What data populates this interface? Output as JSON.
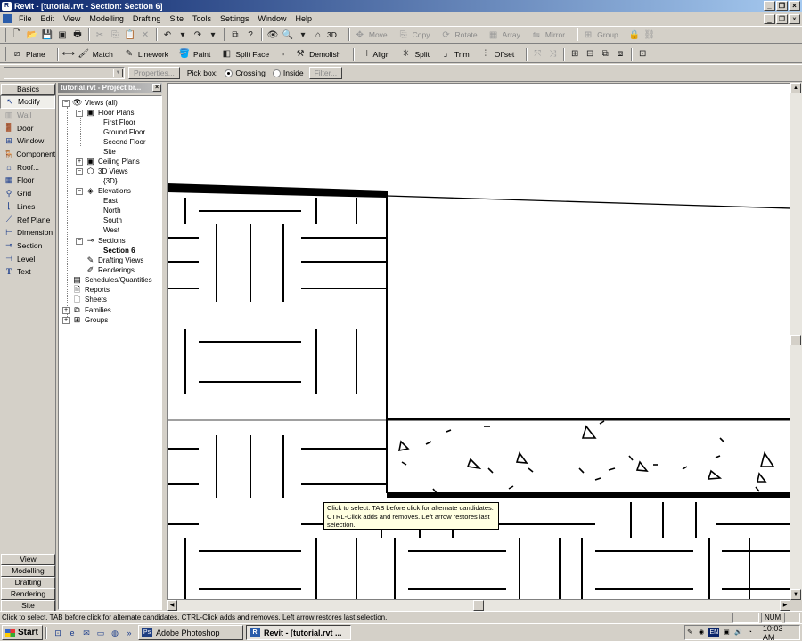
{
  "window": {
    "title": "Revit - [tutorial.rvt - Section: Section 6]"
  },
  "menu": [
    "File",
    "Edit",
    "View",
    "Modelling",
    "Drafting",
    "Site",
    "Tools",
    "Settings",
    "Window",
    "Help"
  ],
  "toolbar1": {
    "view3d_label": "3D",
    "edit_tools": [
      "Move",
      "Copy",
      "Rotate",
      "Array",
      "Mirror",
      "Group"
    ]
  },
  "toolbar2": {
    "tools": [
      "Plane",
      "Match",
      "Linework",
      "Paint",
      "Split Face",
      "Demolish",
      "Align",
      "Split",
      "Trim",
      "Offset"
    ]
  },
  "options_bar": {
    "type_selector_value": "",
    "properties_label": "Properties...",
    "pick_box_label": "Pick box:",
    "crossing_label": "Crossing",
    "inside_label": "Inside",
    "filter_label": "Filter...",
    "pick_mode": "Crossing"
  },
  "design_bar": {
    "active_tab": "Basics",
    "items": [
      "Modify",
      "Wall",
      "Door",
      "Window",
      "Component",
      "Roof...",
      "Floor",
      "Grid",
      "Lines",
      "Ref Plane",
      "Dimension",
      "Section",
      "Level",
      "Text"
    ],
    "bottom_tabs": [
      "View",
      "Modelling",
      "Drafting",
      "Rendering",
      "Site"
    ]
  },
  "project_browser": {
    "title": "tutorial.rvt - Project br...",
    "nodes": [
      "Views (all)",
      "Floor Plans",
      "First Floor",
      "Ground Floor",
      "Second Floor",
      "Site",
      "Ceiling Plans",
      "3D Views",
      "{3D}",
      "Elevations",
      "East",
      "North",
      "South",
      "West",
      "Sections",
      "Section 6",
      "Drafting Views",
      "Renderings",
      "Schedules/Quantities",
      "Reports",
      "Sheets",
      "Families",
      "Groups"
    ],
    "selected": "Section 6"
  },
  "tooltip": "Click to select. TAB before click for alternate candidates. CTRL-Click adds and removes. Left arrow restores last selection.",
  "status": {
    "text": "Click to select. TAB before click for alternate candidates. CTRL-Click adds and removes. Left arrow restores last selection.",
    "num": "NUM"
  },
  "taskbar": {
    "start_label": "Start",
    "tasks": [
      "Adobe Photoshop",
      "Revit - [tutorial.rvt ..."
    ],
    "active_task": "Revit - [tutorial.rvt ...",
    "language": "EN",
    "clock": "10:03 AM"
  }
}
